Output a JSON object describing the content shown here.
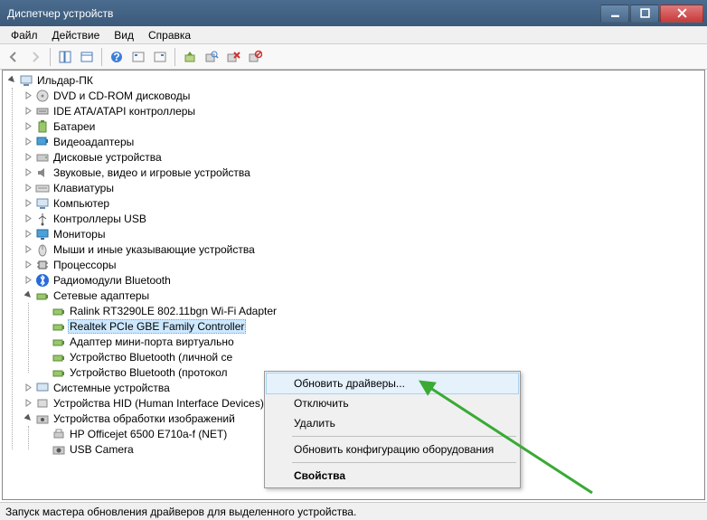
{
  "window": {
    "title": "Диспетчер устройств"
  },
  "menu": {
    "file": "Файл",
    "action": "Действие",
    "view": "Вид",
    "help": "Справка"
  },
  "tree": {
    "root": "Ильдар-ПК",
    "cat": {
      "dvd": "DVD и CD-ROM дисководы",
      "ide": "IDE ATA/ATAPI контроллеры",
      "bat": "Батареи",
      "vid": "Видеоадаптеры",
      "disk": "Дисковые устройства",
      "audio": "Звуковые, видео и игровые устройства",
      "kbd": "Клавиатуры",
      "comp": "Компьютер",
      "usb": "Контроллеры USB",
      "mon": "Мониторы",
      "mouse": "Мыши и иные указывающие устройства",
      "cpu": "Процессоры",
      "bt": "Радиомодули Bluetooth",
      "net": "Сетевые адаптеры",
      "sys": "Системные устройства",
      "hid": "Устройства HID (Human Interface Devices)",
      "img": "Устройства обработки изображений"
    },
    "net_children": {
      "ralink": "Ralink RT3290LE 802.11bgn Wi-Fi Adapter",
      "realtek": "Realtek PCIe GBE Family Controller",
      "miniport": "Адаптер мини-порта виртуально",
      "bt_pers": "Устройство Bluetooth (личной се",
      "bt_proto": "Устройство Bluetooth (протокол"
    },
    "img_children": {
      "hp": "HP Officejet 6500 E710a-f (NET)",
      "cam": "USB Camera"
    }
  },
  "context_menu": {
    "update": "Обновить драйверы...",
    "disable": "Отключить",
    "delete": "Удалить",
    "scan": "Обновить конфигурацию оборудования",
    "props": "Свойства"
  },
  "status": "Запуск мастера обновления драйверов для выделенного устройства."
}
